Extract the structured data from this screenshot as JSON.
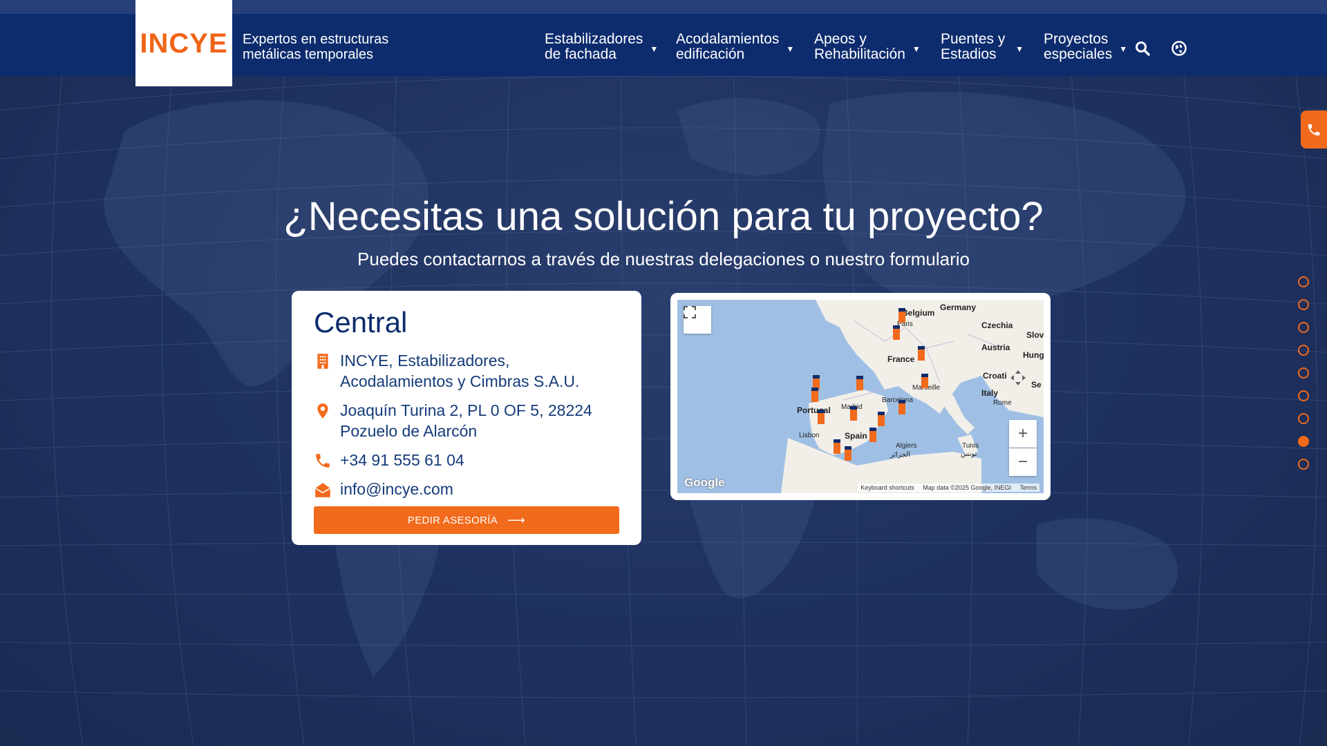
{
  "brand": {
    "logo": "INCYE",
    "tagline": "Expertos en estructuras metálicas temporales",
    "color_primary": "#0d2c6e",
    "color_accent": "#f26a1b"
  },
  "nav": {
    "items": [
      {
        "label": "Estabilizadores de fachada"
      },
      {
        "label": "Acodalamientos edificación"
      },
      {
        "label": "Apeos y Rehabilitación"
      },
      {
        "label": "Puentes y Estadios"
      },
      {
        "label": "Proyectos especiales"
      }
    ],
    "search_icon": "search-icon",
    "language_icon": "globe-icon"
  },
  "hero": {
    "title": "¿Necesitas una solución para tu proyecto?",
    "subtitle": "Puedes contactarnos a través de nuestras delegaciones o nuestro formulario"
  },
  "card": {
    "title": "Central",
    "company": "INCYE, Estabilizadores, Acodalamientos y Cimbras S.A.U.",
    "address": "Joaquín Turina 2, PL 0 OF 5, 28224 Pozuelo de Alarcón",
    "phone": "+34 91 555 61 04",
    "email": "info@incye.com",
    "cta": "PEDIR ASESORÍA"
  },
  "map": {
    "labels": {
      "germany": "Germany",
      "belgium": "Belgium",
      "czechia": "Czechia",
      "slov": "Slov",
      "paris": "Paris",
      "austria": "Austria",
      "hung": "Hung",
      "france": "France",
      "croatia": "Croati",
      "se": "Se",
      "marseille": "Marseille",
      "italy": "Italy",
      "rome": "Rome",
      "portugal": "Portugal",
      "madrid": "Madrid",
      "barcelona": "Barcelona",
      "lisbon": "Lisbon",
      "spain": "Spain",
      "algiers": "Algiers",
      "algiers_ar": "الجزائر",
      "tunis": "Tunis",
      "tunis_ar": "تونس"
    },
    "google": "Google",
    "keyboard": "Keyboard shortcuts",
    "mapdata": "Map data ©2025 Google, INEGI",
    "terms": "Terms",
    "zoom_in": "+",
    "zoom_out": "−"
  },
  "section_dots": {
    "count": 9,
    "active_index": 7
  }
}
